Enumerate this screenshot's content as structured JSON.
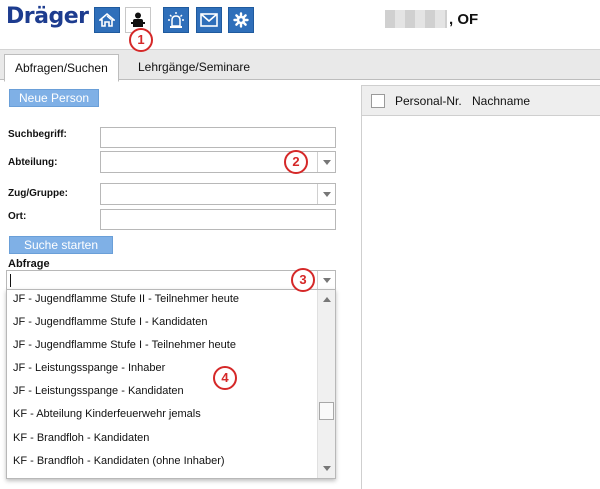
{
  "header": {
    "logo": "Dräger",
    "user_name": ", OF",
    "nav_icons": [
      "home-icon",
      "person-icon",
      "alarm-light-icon",
      "mail-icon",
      "gear-icon"
    ]
  },
  "tabs": [
    {
      "label": "Abfragen/Suchen",
      "active": true
    },
    {
      "label": "Lehrgänge/Seminare",
      "active": false
    }
  ],
  "form": {
    "new_person_label": "Neue Person",
    "suchbegriff_label": "Suchbegriff:",
    "abteilung_label": "Abteilung:",
    "zug_label": "Zug/Gruppe:",
    "ort_label": "Ort:",
    "search_button": "Suche starten",
    "abfrage_label": "Abfrage"
  },
  "dropdown_options": [
    "JF - Jugendflamme Stufe II - Teilnehmer heute",
    "JF - Jugendflamme Stufe I - Kandidaten",
    "JF - Jugendflamme Stufe I - Teilnehmer heute",
    "JF - Leistungsspange - Inhaber",
    "JF - Leistungsspange - Kandidaten",
    "KF - Abteilung Kinderfeuerwehr jemals",
    "KF - Brandfloh - Kandidaten",
    "KF - Brandfloh - Kandidaten (ohne Inhaber)"
  ],
  "results_table": {
    "columns": [
      "Personal-Nr.",
      "Nachname"
    ]
  },
  "callouts": [
    "1",
    "2",
    "3",
    "4"
  ],
  "colors": {
    "brand_blue": "#1d3c8f",
    "nav_blue": "#2f6fba",
    "button_blue": "#7fb0e6",
    "callout_red": "#d52828"
  }
}
